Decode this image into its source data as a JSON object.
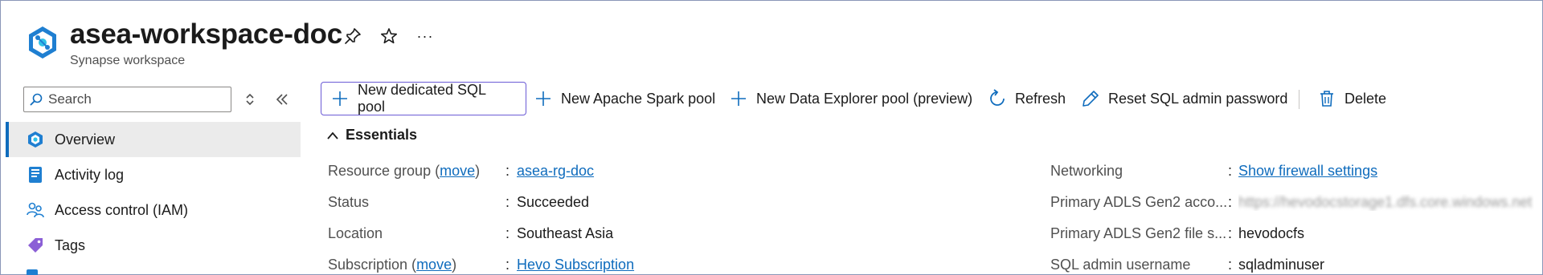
{
  "header": {
    "title": "asea-workspace-doc",
    "subtitle": "Synapse workspace",
    "more_label": "···"
  },
  "sidebar": {
    "search_placeholder": "Search",
    "items": [
      {
        "label": "Overview",
        "icon": "synapse-overview-icon",
        "active": true
      },
      {
        "label": "Activity log",
        "icon": "activity-log-icon",
        "active": false
      },
      {
        "label": "Access control (IAM)",
        "icon": "people-icon",
        "active": false
      },
      {
        "label": "Tags",
        "icon": "tag-icon",
        "active": false
      }
    ]
  },
  "toolbar": {
    "new_dedicated_sql_pool": "New dedicated SQL pool",
    "new_apache_spark_pool": "New Apache Spark pool",
    "new_data_explorer_pool": "New Data Explorer pool (preview)",
    "refresh": "Refresh",
    "reset_sql_admin_password": "Reset SQL admin password",
    "delete": "Delete"
  },
  "essentials": {
    "label": "Essentials",
    "left": {
      "resource_group": {
        "label": "Resource group (",
        "move": "move",
        "close": ")",
        "value": "asea-rg-doc"
      },
      "status": {
        "label": "Status",
        "value": "Succeeded"
      },
      "location": {
        "label": "Location",
        "value": "Southeast Asia"
      },
      "subscription": {
        "label": "Subscription (",
        "move": "move",
        "close": ")",
        "value": "Hevo Subscription"
      }
    },
    "right": {
      "networking": {
        "label": "Networking",
        "value": "Show firewall settings"
      },
      "primary_adls_account": {
        "label": "Primary ADLS Gen2 acco...",
        "value": "https://hevodocstorage1.dfs.core.windows.net"
      },
      "primary_adls_file": {
        "label": "Primary ADLS Gen2 file s...",
        "value": "hevodocfs"
      },
      "sql_admin_username": {
        "label": "SQL admin username",
        "value": "sqladminuser"
      }
    },
    "colon": ":"
  },
  "colors": {
    "accent": "#0f6cbd",
    "primary_border": "#6b5bd6",
    "synapse_blue": "#1f7fd1",
    "synapse_teal": "#30c3e8",
    "tag_purple": "#8b5fd6"
  }
}
